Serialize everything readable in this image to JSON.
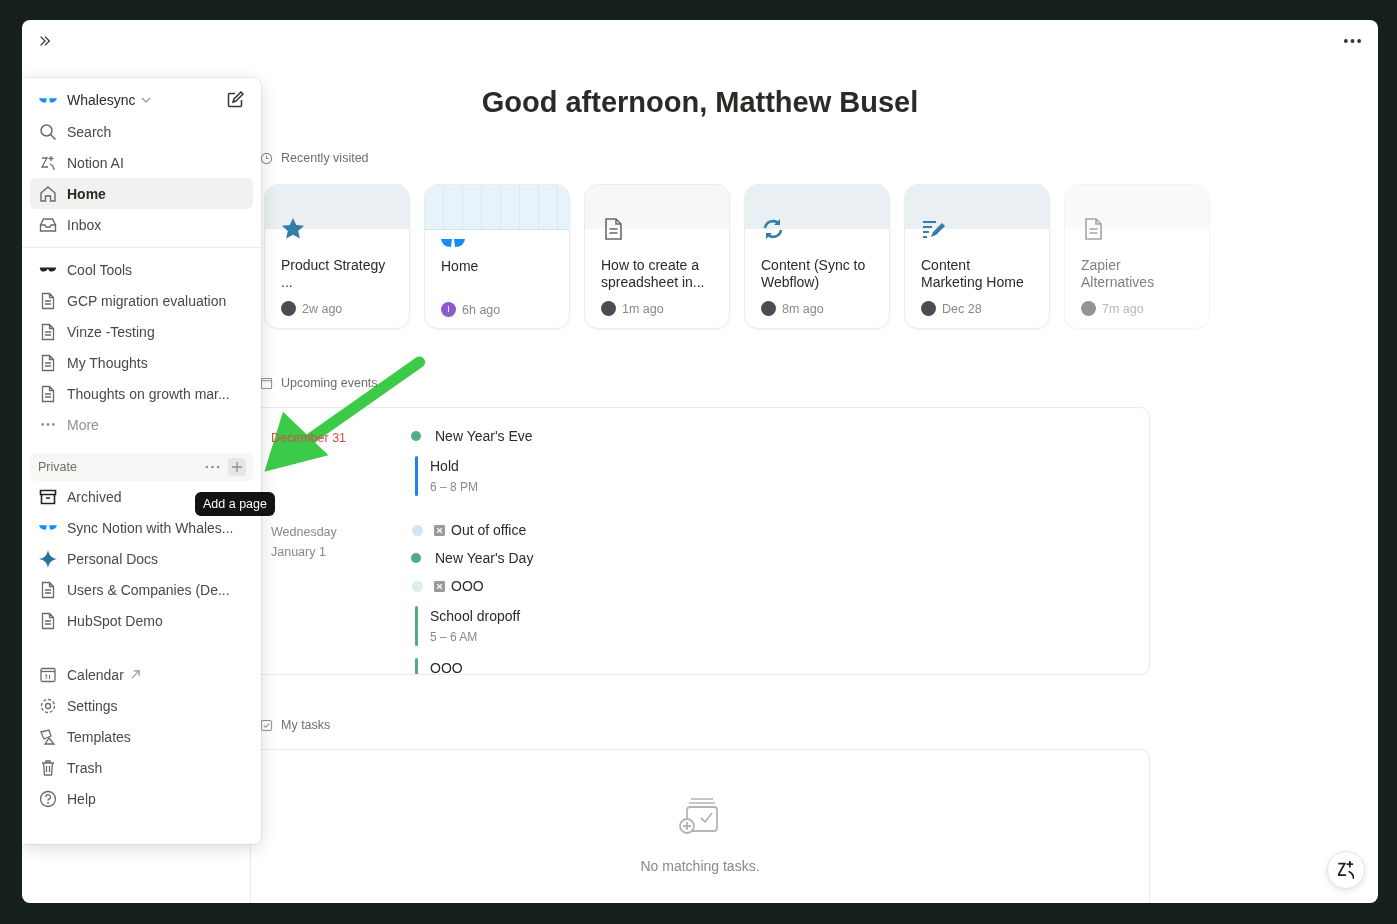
{
  "greeting": "Good afternoon, Matthew Busel",
  "sidebar": {
    "workspace": "Whalesync",
    "nav": [
      {
        "label": "Search",
        "kind": "search",
        "selected": false
      },
      {
        "label": "Notion AI",
        "kind": "ai",
        "selected": false
      },
      {
        "label": "Home",
        "kind": "home",
        "selected": true
      },
      {
        "label": "Inbox",
        "kind": "inbox",
        "selected": false
      }
    ],
    "pages": [
      {
        "label": "Cool Tools",
        "kind": "glasses"
      },
      {
        "label": "GCP migration evaluation",
        "kind": "page"
      },
      {
        "label": "Vinze -Testing",
        "kind": "page"
      },
      {
        "label": "My Thoughts",
        "kind": "page"
      },
      {
        "label": "Thoughts on growth mar...",
        "kind": "page"
      }
    ],
    "more": "More",
    "private": {
      "label": "Private",
      "tooltip": "Add a page"
    },
    "private_pages": [
      {
        "label": "Archived",
        "kind": "archive"
      },
      {
        "label": "Sync Notion with Whales...",
        "kind": "logo"
      },
      {
        "label": "Personal Docs",
        "kind": "diamond"
      },
      {
        "label": "Users & Companies (De...",
        "kind": "page"
      },
      {
        "label": "HubSpot Demo",
        "kind": "page"
      }
    ],
    "footer": [
      {
        "label": "Calendar",
        "kind": "calendar",
        "external": true
      },
      {
        "label": "Settings",
        "kind": "gear",
        "external": false
      },
      {
        "label": "Templates",
        "kind": "shapes",
        "external": false
      },
      {
        "label": "Trash",
        "kind": "trash",
        "external": false
      },
      {
        "label": "Help",
        "kind": "help",
        "external": false
      }
    ]
  },
  "recently_visited": {
    "title": "Recently visited",
    "cards": [
      {
        "title": "Product Strategy ...",
        "time": "2w ago"
      },
      {
        "title": "Home",
        "time": "6h ago",
        "initial": "I"
      },
      {
        "title": "How to create a spreadsheet in...",
        "time": "1m ago"
      },
      {
        "title": "Content (Sync to Webflow)",
        "time": "8m ago"
      },
      {
        "title": "Content Marketing Home",
        "time": "Dec 28"
      },
      {
        "title": "Zapier Alternatives",
        "time": "7m ago"
      }
    ]
  },
  "upcoming_events": {
    "title": "Upcoming events",
    "days": [
      {
        "lines": [
          "December 31"
        ],
        "today": true,
        "events": [
          {
            "kind": "allday",
            "title": "New Year's Eve",
            "color": "#4caf7d"
          },
          {
            "kind": "timed",
            "title": "Hold",
            "time": "6 – 8 PM",
            "color": "#2383e2"
          }
        ]
      },
      {
        "lines": [
          "Wednesday",
          "January 1"
        ],
        "today": false,
        "events": [
          {
            "kind": "blocked",
            "title": "Out of office",
            "color": "#d3e5f5"
          },
          {
            "kind": "allday",
            "title": "New Year's Day",
            "color": "#4caf7d"
          },
          {
            "kind": "blocked",
            "title": "OOO",
            "color": "#dcefe5"
          },
          {
            "kind": "timed",
            "title": "School dropoff",
            "time": "5 – 6 AM",
            "color": "#4caf7d"
          },
          {
            "kind": "timed",
            "title": "OOO",
            "color": "#4caf7d"
          }
        ]
      }
    ]
  },
  "my_tasks": {
    "title": "My tasks",
    "empty": "No matching tasks."
  }
}
